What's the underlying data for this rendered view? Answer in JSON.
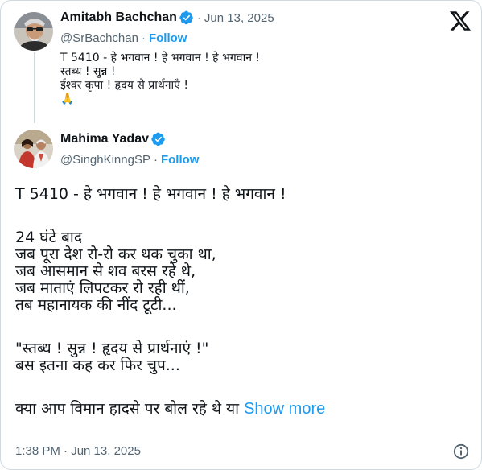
{
  "quoted_post": {
    "display_name": "Amitabh Bachchan",
    "date": "Jun 13, 2025",
    "handle": "@SrBachchan",
    "follow_label": "Follow",
    "lines": [
      "T 5410 - हे भगवान  ! हे भगवान  ! हे  भगवान  !",
      "स्तब्ध  ! सुन्न  !",
      "ईश्वर कृपा  ! हृदय से प्रार्थनाएँ  !",
      "🙏"
    ]
  },
  "post": {
    "display_name": "Mahima Yadav",
    "handle": "@SinghKinngSP",
    "follow_label": "Follow",
    "lines": [
      "T 5410 - हे भगवान ! हे भगवान ! हे भगवान !",
      "",
      "24 घंटे बाद",
      "जब पूरा देश रो-रो कर थक चुका था,",
      "जब आसमान से शव बरस रहे थे,",
      "जब माताएं लिपटकर रो रही थीं,",
      "तब महानायक की नींद टूटी...",
      "",
      "\"स्तब्ध ! सुन्न ! हृदय से प्रार्थनाएं !\"",
      "बस इतना कह कर फिर चुप...",
      ""
    ],
    "last_line": "क्या आप विमान हादसे पर बोल रहे थे या",
    "show_more_label": "Show more",
    "timestamp": "1:38 PM · Jun 13, 2025"
  },
  "icons": {
    "logo": "x-logo-icon",
    "verified": "verified-badge-icon",
    "info": "info-icon"
  },
  "colors": {
    "link": "#1d9bf0",
    "secondary_text": "#536471",
    "border": "#cfd9de"
  }
}
